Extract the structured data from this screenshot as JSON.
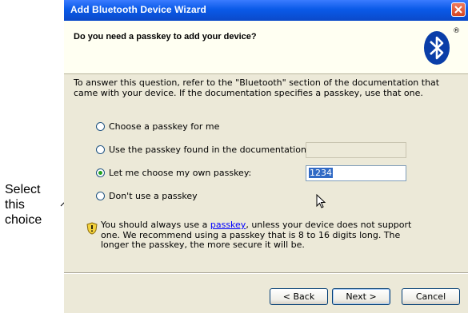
{
  "callout": {
    "line1": "Select",
    "line2": "this",
    "line3": "choice"
  },
  "window": {
    "title": "Add Bluetooth Device Wizard",
    "header_title": "Do you need a passkey to add your device?",
    "registered_mark": "®",
    "description": "To answer this question, refer to the \"Bluetooth\" section of the documentation that came with your device. If the documentation specifies a passkey, use that one.",
    "options": [
      {
        "label": "Choose a passkey for me",
        "selected": false
      },
      {
        "label": "Use the passkey found in the documentation:",
        "selected": false
      },
      {
        "label": "Let me choose my own passkey:",
        "selected": true
      },
      {
        "label": "Don't use a passkey",
        "selected": false
      }
    ],
    "passkey_value": "1234",
    "info": {
      "before": "You should always use a ",
      "link": "passkey",
      "after": ", unless your device does not support one. We recommend using a passkey that is 8 to 16 digits long. The longer the passkey, the more secure it will be."
    },
    "buttons": {
      "back": "< Back",
      "next": "Next >",
      "cancel": "Cancel"
    }
  }
}
